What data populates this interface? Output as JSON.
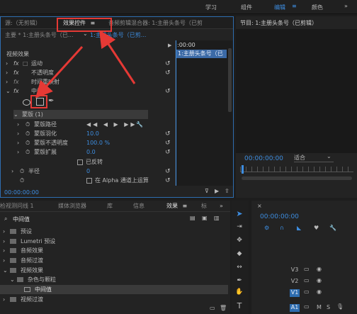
{
  "workspace_tabs": [
    "学习",
    "组件",
    "编辑",
    "颜色"
  ],
  "workspace_active": "编辑",
  "source_tab": "源:（无剪辑）",
  "effect_controls_tab": "效果控件",
  "audio_mixer_tab": "音频剪辑混合器: 1:主册头条号（已剪",
  "program_tab": "节目: 1:主册头条号（已剪辑）",
  "master_label": "主要 * 1:主册头条号（已...",
  "clip_label": "1:主册头条号（已剪...",
  "timeline_start": ":00:00",
  "timeline_clip": "1:主册头条号（已",
  "section_video_effects": "视频效果",
  "effects": [
    {
      "name": "运动",
      "prefix": "fx"
    },
    {
      "name": "不透明度",
      "prefix": "fx"
    },
    {
      "name": "时间重映射",
      "prefix": "fx"
    },
    {
      "name": "中间值",
      "prefix": "fx"
    }
  ],
  "mask_group": "蒙版 (1)",
  "mask_props": [
    {
      "name": "蒙版路径",
      "value": ""
    },
    {
      "name": "蒙版羽化",
      "value": "10.0"
    },
    {
      "name": "蒙版不透明度",
      "value": "100.0 %"
    },
    {
      "name": "蒙版扩展",
      "value": "0.0"
    }
  ],
  "inverted_label": "已反转",
  "radius_label": "半径",
  "radius_value": "0",
  "alpha_label": "在 Alpha 通道上运算",
  "ec_timecode": "00:00:00:00",
  "program_timecode": "00:00:00:00",
  "fit_label": "适合",
  "bottom_tabs": [
    "检视测问线 1",
    "媒体浏览器",
    "库",
    "信息",
    "效果",
    "标"
  ],
  "bottom_active": "效果",
  "search_value": "中间值",
  "tree": [
    {
      "label": "预设",
      "level": 0
    },
    {
      "label": "Lumetri 预设",
      "level": 0
    },
    {
      "label": "音频效果",
      "level": 0
    },
    {
      "label": "音频过渡",
      "level": 0
    },
    {
      "label": "视频效果",
      "level": 0
    },
    {
      "label": "杂色与颗粒",
      "level": 1
    },
    {
      "label": "中间值",
      "level": 2
    },
    {
      "label": "视频过渡",
      "level": 0
    }
  ],
  "seq_timecode": "00:00:00:00",
  "tracks": [
    {
      "name": "V3",
      "active": false
    },
    {
      "name": "V2",
      "active": false
    },
    {
      "name": "V1",
      "active": true
    },
    {
      "name": "A1",
      "active": true
    }
  ],
  "track_a1_extra": [
    "M",
    "S"
  ],
  "colors": {
    "accent": "#3d8de0",
    "highlight": "#e53935",
    "bg": "#1d1d1d",
    "panel": "#232323"
  }
}
